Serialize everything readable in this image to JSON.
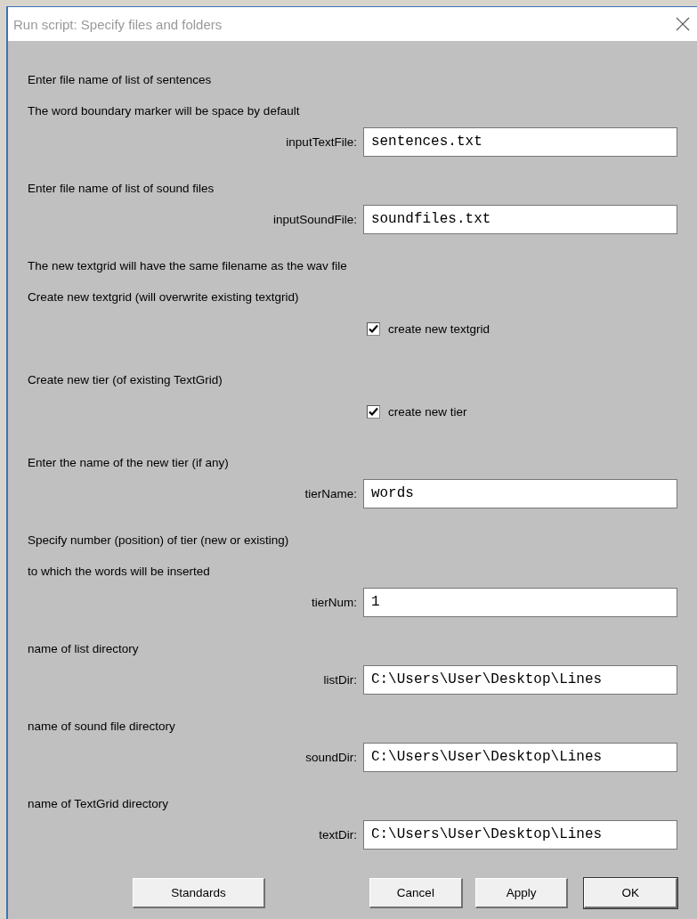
{
  "window": {
    "title": "Run script: Specify files and folders"
  },
  "fields": [
    {
      "kind": "label",
      "text": "Enter file name of list of sentences"
    },
    {
      "kind": "label",
      "text": "The word boundary marker will be space by default"
    },
    {
      "kind": "field",
      "label": "inputTextFile:",
      "value": "sentences.txt"
    },
    {
      "kind": "label",
      "text": "Enter file name of list of sound files"
    },
    {
      "kind": "field",
      "label": "inputSoundFile:",
      "value": "soundfiles.txt"
    },
    {
      "kind": "label",
      "text": "The new textgrid will have the same filename as the wav file"
    },
    {
      "kind": "label",
      "text": "Create new textgrid (will overwrite existing textgrid)"
    },
    {
      "kind": "checkbox",
      "label": "create new textgrid",
      "checked": true
    },
    {
      "kind": "label",
      "text": "Create new tier (of existing TextGrid)"
    },
    {
      "kind": "checkbox",
      "label": "create new tier",
      "checked": true
    },
    {
      "kind": "label",
      "text": "Enter the name of the new tier (if any)"
    },
    {
      "kind": "field",
      "label": "tierName:",
      "value": "words"
    },
    {
      "kind": "label",
      "text": "Specify number (position) of tier (new or existing)"
    },
    {
      "kind": "label",
      "text": "to which the words will be inserted"
    },
    {
      "kind": "field",
      "label": "tierNum:",
      "value": "1"
    },
    {
      "kind": "label",
      "text": "name of list directory"
    },
    {
      "kind": "field",
      "label": "listDir:",
      "value": "C:\\Users\\User\\Desktop\\Lines"
    },
    {
      "kind": "label",
      "text": "name of sound file directory"
    },
    {
      "kind": "field",
      "label": "soundDir:",
      "value": "C:\\Users\\User\\Desktop\\Lines"
    },
    {
      "kind": "label",
      "text": "name of TextGrid directory"
    },
    {
      "kind": "field",
      "label": "textDir:",
      "value": "C:\\Users\\User\\Desktop\\Lines"
    }
  ],
  "buttons": [
    {
      "label": "Standards",
      "default": false
    },
    {
      "label": "Cancel",
      "default": false
    },
    {
      "label": "Apply",
      "default": false
    },
    {
      "label": "OK",
      "default": true
    }
  ]
}
